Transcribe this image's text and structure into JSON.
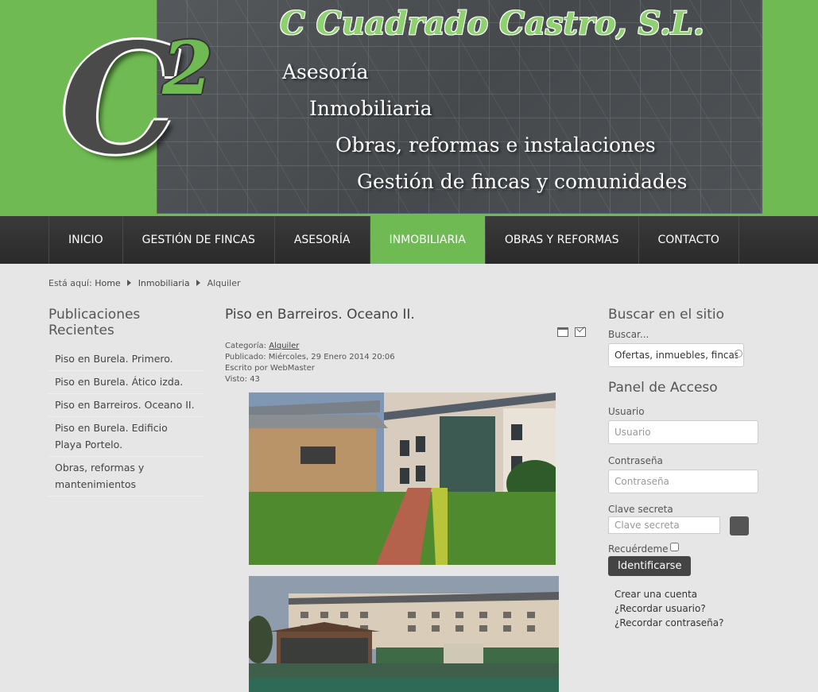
{
  "header": {
    "logo_letter": "C",
    "logo_superscript": "2",
    "company_name": "C Cuadrado Castro, S.L.",
    "taglines": [
      "Asesoría",
      "Inmobiliaria",
      "Obras, reformas e instalaciones",
      "Gestión de fincas y comunidades"
    ]
  },
  "nav": {
    "items": [
      {
        "label": "INICIO"
      },
      {
        "label": "GESTIÓN DE FINCAS"
      },
      {
        "label": "ASESORÍA"
      },
      {
        "label": "INMOBILIARIA",
        "active": true
      },
      {
        "label": "OBRAS Y REFORMAS"
      },
      {
        "label": "CONTACTO"
      }
    ],
    "active_color": "#6fba52"
  },
  "breadcrumb": {
    "prefix": "Está aquí:",
    "items": [
      "Home",
      "Inmobiliaria",
      "Alquiler"
    ]
  },
  "sidebar_left": {
    "title": "Publicaciones Recientes",
    "items": [
      "Piso en Burela. Primero.",
      "Piso en Burela. Ático izda.",
      "Piso en Barreiros. Oceano II.",
      "Piso en Burela. Edificio Playa Portelo.",
      "Obras, reformas y mantenimientos"
    ]
  },
  "article": {
    "title": "Piso en Barreiros. Oceano II.",
    "category_label": "Categoría:",
    "category": "Alquiler",
    "published": "Publicado: Miércoles, 29 Enero 2014 20:06",
    "author": "Escrito por WebMaster",
    "views": "Visto: 43",
    "icons": [
      "print-icon",
      "email-icon"
    ]
  },
  "sidebar_right": {
    "search": {
      "title": "Buscar en el sitio",
      "label": "Buscar...",
      "placeholder": "Ofertas, inmuebles, fincas"
    },
    "login": {
      "title": "Panel de Acceso",
      "user_label": "Usuario",
      "user_placeholder": "Usuario",
      "password_label": "Contraseña",
      "password_placeholder": "Contraseña",
      "secret_label": "Clave secreta",
      "secret_placeholder": "Clave secreta",
      "remember_label": "Recuérdeme",
      "submit_label": "Identificarse",
      "links": [
        "Crear una cuenta",
        "¿Recordar usuario?",
        "¿Recordar contraseña?"
      ]
    }
  }
}
